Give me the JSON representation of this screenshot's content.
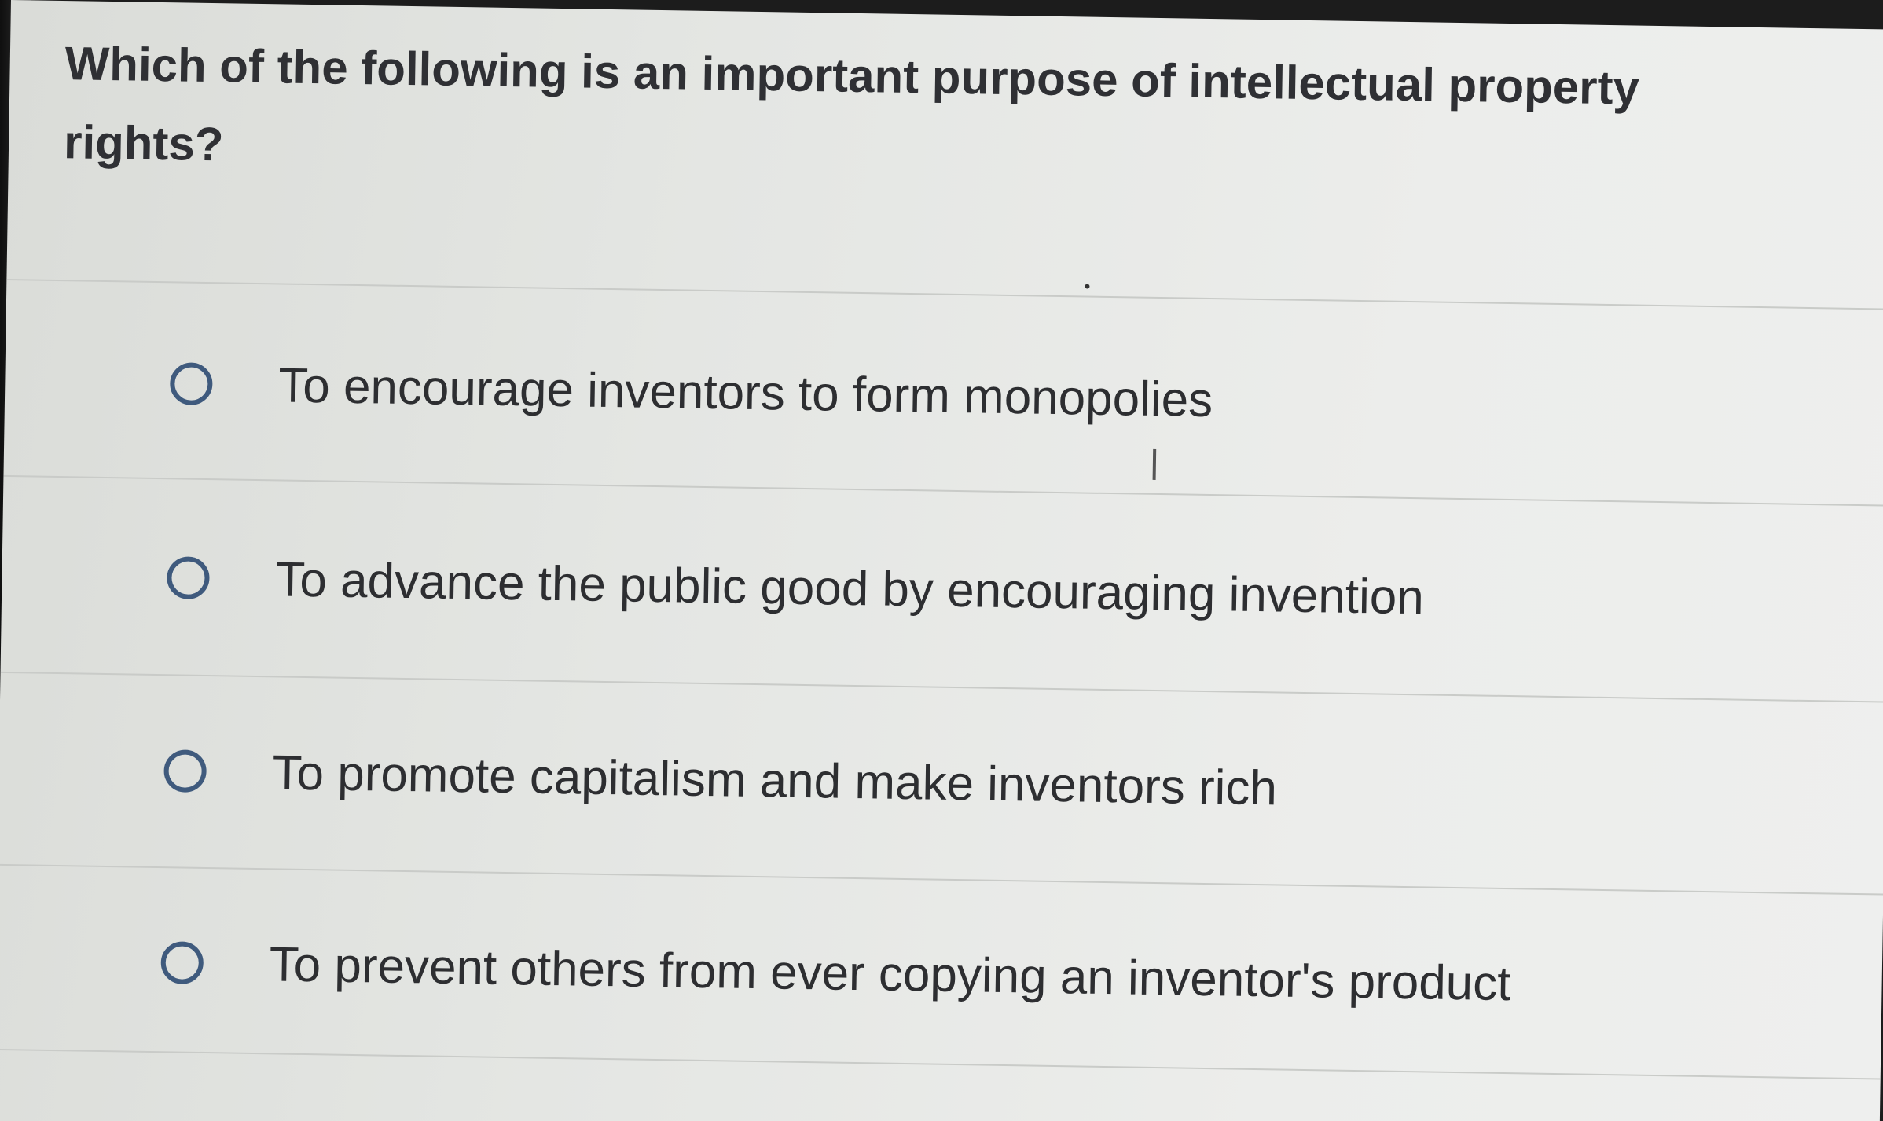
{
  "question": {
    "text": "Which of the following is an important purpose of intellectual property rights?"
  },
  "options": [
    {
      "label": "To encourage inventors to form monopolies",
      "selected": false
    },
    {
      "label": "To advance the public good by encouraging invention",
      "selected": false
    },
    {
      "label": "To promote capitalism and make inventors rich",
      "selected": false
    },
    {
      "label": "To prevent others from ever copying an inventor's product",
      "selected": false
    }
  ],
  "colors": {
    "radio_border": "#3f5a7d",
    "text": "#2d2e31",
    "background": "#e6e8e5"
  },
  "icons": {
    "radio": "radio-unselected-icon"
  }
}
